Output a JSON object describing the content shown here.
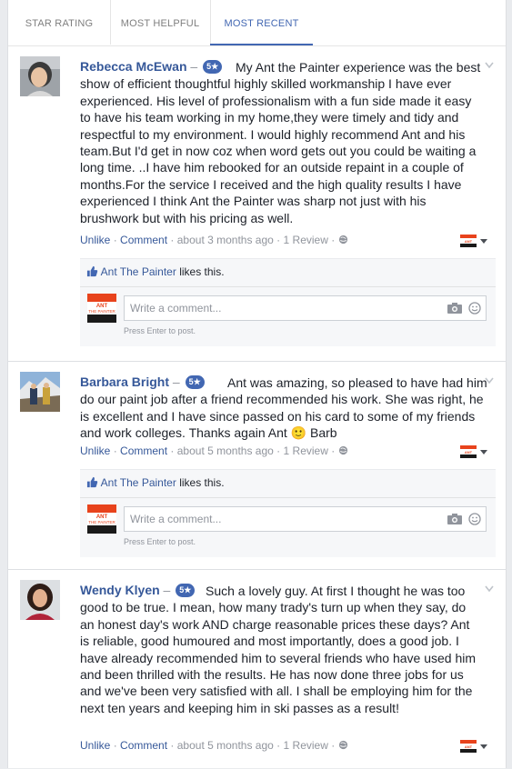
{
  "tabs": [
    {
      "label": "STAR RATING"
    },
    {
      "label": "MOST HELPFUL"
    },
    {
      "label": "MOST RECENT"
    }
  ],
  "reviews": [
    {
      "author": "Rebecca McEwan",
      "separator": "–",
      "rating_badge": "5★",
      "text": "My Ant the Painter experience was the best show of efficient thoughtful highly skilled workmanship I have ever experienced. His level of professionalism with a fun side made it easy to have his team working in my home,they were timely and tidy and respectful to my environment. I would highly recommend Ant and his team.But I'd get in now coz when word gets out you could be waiting a long time. ..I have him rebooked for an outside repaint in a couple of months.For the service I received and the high quality results I have experienced I think Ant the Painter was sharp not just with his brushwork but with his pricing as well.",
      "unlike": "Unlike",
      "comment": "Comment",
      "time": "about 3 months ago",
      "review_count": "1 Review",
      "likes_page": "Ant The Painter",
      "likes_suffix": "likes this.",
      "comment_placeholder": "Write a comment...",
      "press_enter": "Press Enter to post."
    },
    {
      "author": "Barbara Bright",
      "separator": "–",
      "rating_badge": "5★",
      "text": "Ant was amazing, so pleased to have had him do our paint job after a friend recommended his work. She was right, he is excellent and I have since passed on his card to some of my friends and work colleges. Thanks again Ant 🙂 Barb",
      "unlike": "Unlike",
      "comment": "Comment",
      "time": "about 5 months ago",
      "review_count": "1 Review",
      "likes_page": "Ant The Painter",
      "likes_suffix": "likes this.",
      "comment_placeholder": "Write a comment...",
      "press_enter": "Press Enter to post."
    },
    {
      "author": "Wendy Klyen",
      "separator": "–",
      "rating_badge": "5★",
      "text": "Such a lovely guy. At first I thought he was too good to be true. I mean, how many trady's turn up when they say, do an honest day's work AND charge reasonable prices these days? Ant is reliable, good humoured and most importantly, does a good job. I have already recommended him to several friends who have used him and been thrilled with the results. He has now done three jobs for us and we've been very satisfied with all. I shall be employing him for the next ten years and keeping him in ski passes as a result!",
      "unlike": "Unlike",
      "comment": "Comment",
      "time": "about 5 months ago",
      "review_count": "1 Review"
    }
  ],
  "meta_dot": "·",
  "colors": {
    "accent": "#4267b2",
    "link": "#365899",
    "brand_orange": "#e8431c",
    "brand_black": "#1a1a1a"
  },
  "icons": [
    "chevron-down-icon",
    "globe-icon",
    "thumbs-up-icon",
    "camera-icon",
    "smiley-icon",
    "caret-down-icon"
  ]
}
